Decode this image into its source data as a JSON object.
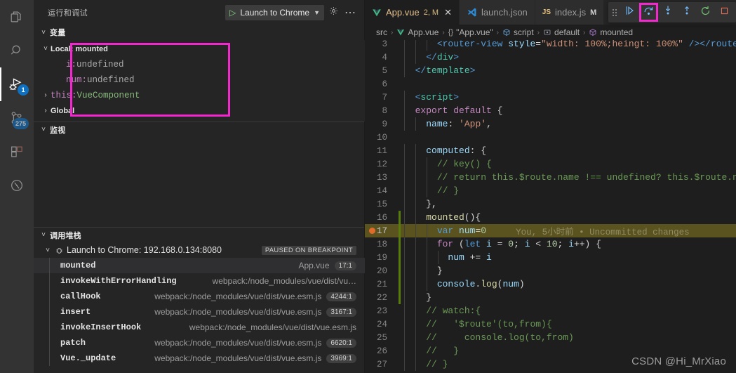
{
  "activitybar": {
    "items": [
      {
        "name": "explorer",
        "icon": "files-icon",
        "badge": null,
        "active": false
      },
      {
        "name": "search",
        "icon": "search-icon",
        "badge": null,
        "active": false
      },
      {
        "name": "run-and-debug",
        "icon": "debug-icon",
        "badge": "1",
        "active": true
      },
      {
        "name": "source-control",
        "icon": "source-control-icon",
        "badge": "275",
        "active": false
      },
      {
        "name": "extensions",
        "icon": "extensions-icon",
        "badge": null,
        "active": false
      },
      {
        "name": "testing",
        "icon": "beaker-clock-icon",
        "badge": null,
        "active": false
      }
    ]
  },
  "sidebar": {
    "title": "运行和调试",
    "launch_config": {
      "label": "Launch to Chrome",
      "play_icon": "play-icon",
      "chevron": "chevron-down-icon"
    },
    "gear_icon": "gear-icon",
    "more_icon": "ellipsis-icon",
    "sections": {
      "variables": {
        "title": "变量",
        "arrow": "chevron-down-icon",
        "highlight_color": "#f227cd",
        "rows": [
          {
            "indent": 0,
            "twisty": "chevron-down-icon",
            "scope": "Local: mounted"
          },
          {
            "indent": 1,
            "twisty": null,
            "key": "i",
            "sep": ": ",
            "value": "undefined"
          },
          {
            "indent": 1,
            "twisty": null,
            "key": "num",
            "sep": ": ",
            "value": "undefined"
          },
          {
            "indent": 0,
            "twisty": "chevron-right-icon",
            "key": "this",
            "sep": ": ",
            "type": "VueComponent"
          },
          {
            "indent": 0,
            "twisty": "chevron-right-icon",
            "scope": "Global"
          }
        ]
      },
      "watch": {
        "title": "监视",
        "arrow": "chevron-down-icon",
        "items": []
      },
      "callstack": {
        "title": "调用堆栈",
        "arrow": "chevron-down-icon",
        "session": {
          "arrow": "chevron-down-icon",
          "icon": "debug-session-icon",
          "label": "Launch to Chrome: 192.168.0.134:8080",
          "status": "PAUSED ON BREAKPOINT"
        },
        "frames": [
          {
            "fn": "mounted",
            "src": "App.vue",
            "line": "17:1",
            "selected": true
          },
          {
            "fn": "invokeWithErrorHandling",
            "src": "webpack:/node_modules/vue/dist/vu…",
            "line": null,
            "selected": false
          },
          {
            "fn": "callHook",
            "src": "webpack:/node_modules/vue/dist/vue.esm.js",
            "line": "4244:1",
            "selected": false
          },
          {
            "fn": "insert",
            "src": "webpack:/node_modules/vue/dist/vue.esm.js",
            "line": "3167:1",
            "selected": false
          },
          {
            "fn": "invokeInsertHook",
            "src": "webpack:/node_modules/vue/dist/vue.esm.js",
            "line": null,
            "selected": false
          },
          {
            "fn": "patch",
            "src": "webpack:/node_modules/vue/dist/vue.esm.js",
            "line": "6620:1",
            "selected": false
          },
          {
            "fn": "Vue._update",
            "src": "webpack:/node_modules/vue/dist/vue.esm.js",
            "line": "3969:1",
            "selected": false
          }
        ]
      }
    }
  },
  "editor": {
    "tabs": [
      {
        "name": "App.vue",
        "icon": "vue-icon",
        "badge": "2, M",
        "active": true,
        "close_icon": "close-icon",
        "modified": false
      },
      {
        "name": "launch.json",
        "icon": "vscode-icon",
        "badge": null,
        "active": false,
        "modified": false
      },
      {
        "name": "index.js",
        "icon": "js-icon",
        "badge": null,
        "active": false,
        "modified": true,
        "mod_mark": "M"
      }
    ],
    "debug_toolbar": {
      "grip_icon": "drag-handle-icon",
      "buttons": [
        {
          "name": "continue-button",
          "icon": "continue-icon",
          "highlighted": false
        },
        {
          "name": "step-over-button",
          "icon": "step-over-icon",
          "highlighted": true
        },
        {
          "name": "step-into-button",
          "icon": "step-into-icon",
          "highlighted": false
        },
        {
          "name": "step-out-button",
          "icon": "step-out-icon",
          "highlighted": false
        },
        {
          "name": "restart-button",
          "icon": "restart-icon",
          "highlighted": false
        },
        {
          "name": "stop-button",
          "icon": "stop-icon",
          "highlighted": false
        }
      ],
      "highlight_color": "#f227cd"
    },
    "breadcrumb": [
      {
        "text": "src",
        "icon": null
      },
      {
        "text": "App.vue",
        "icon": "vue-icon"
      },
      {
        "text": "\"App.vue\"",
        "icon": "braces-icon"
      },
      {
        "text": "script",
        "icon": "symbol-namespace-icon"
      },
      {
        "text": "default",
        "icon": "symbol-object-icon"
      },
      {
        "text": "mounted",
        "icon": "symbol-method-icon"
      }
    ],
    "blame_annotation": "You, 5小时前 • Uncommitted changes",
    "lines": [
      {
        "n": "3",
        "clipped": true,
        "segments": [
          {
            "t": "plain",
            "s": "      "
          },
          {
            "t": "tag",
            "s": "<router-view"
          },
          {
            "t": "prop",
            "s": " style"
          },
          {
            "t": "punc",
            "s": "="
          },
          {
            "t": "str",
            "s": "\"width: 100%;heingt: 100%\""
          },
          {
            "t": "tag",
            "s": " /></router-"
          }
        ]
      },
      {
        "n": "4",
        "segments": [
          {
            "t": "plain",
            "s": "    "
          },
          {
            "t": "tag",
            "s": "</"
          },
          {
            "t": "tagname2",
            "s": "div"
          },
          {
            "t": "tag",
            "s": ">"
          }
        ]
      },
      {
        "n": "5",
        "segments": [
          {
            "t": "plain",
            "s": "  "
          },
          {
            "t": "tag",
            "s": "</"
          },
          {
            "t": "tagname2",
            "s": "template"
          },
          {
            "t": "tag",
            "s": ">"
          }
        ]
      },
      {
        "n": "6",
        "segments": []
      },
      {
        "n": "7",
        "segments": [
          {
            "t": "plain",
            "s": "  "
          },
          {
            "t": "tag",
            "s": "<"
          },
          {
            "t": "tagname2",
            "s": "script"
          },
          {
            "t": "tag",
            "s": ">"
          }
        ]
      },
      {
        "n": "8",
        "segments": [
          {
            "t": "plain",
            "s": "  "
          },
          {
            "t": "kw",
            "s": "export"
          },
          {
            "t": "plain",
            "s": " "
          },
          {
            "t": "kw",
            "s": "default"
          },
          {
            "t": "punc",
            "s": " {"
          }
        ]
      },
      {
        "n": "9",
        "segments": [
          {
            "t": "plain",
            "s": "    "
          },
          {
            "t": "prop",
            "s": "name"
          },
          {
            "t": "punc",
            "s": ": "
          },
          {
            "t": "str",
            "s": "'App'"
          },
          {
            "t": "punc",
            "s": ","
          }
        ]
      },
      {
        "n": "10",
        "segments": []
      },
      {
        "n": "11",
        "segments": [
          {
            "t": "plain",
            "s": "    "
          },
          {
            "t": "prop",
            "s": "computed"
          },
          {
            "t": "punc",
            "s": ": {"
          }
        ]
      },
      {
        "n": "12",
        "segments": [
          {
            "t": "plain",
            "s": "      "
          },
          {
            "t": "com",
            "s": "// key() {"
          }
        ]
      },
      {
        "n": "13",
        "segments": [
          {
            "t": "plain",
            "s": "      "
          },
          {
            "t": "com",
            "s": "// return this.$route.name !== undefined? this.$route.name"
          }
        ]
      },
      {
        "n": "14",
        "segments": [
          {
            "t": "plain",
            "s": "      "
          },
          {
            "t": "com",
            "s": "// }"
          }
        ]
      },
      {
        "n": "15",
        "segments": [
          {
            "t": "plain",
            "s": "    "
          },
          {
            "t": "punc",
            "s": "},"
          }
        ]
      },
      {
        "n": "16",
        "changed": true,
        "segments": [
          {
            "t": "plain",
            "s": "    "
          },
          {
            "t": "fn",
            "s": "mounted"
          },
          {
            "t": "punc",
            "s": "(){"
          }
        ]
      },
      {
        "n": "17",
        "changed": true,
        "breakpoint": true,
        "highlight": true,
        "blame": true,
        "segments": [
          {
            "t": "plain",
            "s": "      "
          },
          {
            "t": "kw2",
            "s": "var"
          },
          {
            "t": "plain",
            "s": " "
          },
          {
            "t": "var",
            "s": "num"
          },
          {
            "t": "punc",
            "s": "="
          },
          {
            "t": "num",
            "s": "0"
          }
        ]
      },
      {
        "n": "18",
        "changed": true,
        "segments": [
          {
            "t": "plain",
            "s": "      "
          },
          {
            "t": "kw",
            "s": "for"
          },
          {
            "t": "punc",
            "s": " ("
          },
          {
            "t": "kw2",
            "s": "let"
          },
          {
            "t": "plain",
            "s": " "
          },
          {
            "t": "var",
            "s": "i"
          },
          {
            "t": "punc",
            "s": " = "
          },
          {
            "t": "num",
            "s": "0"
          },
          {
            "t": "punc",
            "s": "; "
          },
          {
            "t": "var",
            "s": "i"
          },
          {
            "t": "punc",
            "s": " < "
          },
          {
            "t": "num",
            "s": "10"
          },
          {
            "t": "punc",
            "s": "; "
          },
          {
            "t": "var",
            "s": "i"
          },
          {
            "t": "punc",
            "s": "++) {"
          }
        ]
      },
      {
        "n": "19",
        "changed": true,
        "segments": [
          {
            "t": "plain",
            "s": "        "
          },
          {
            "t": "var",
            "s": "num"
          },
          {
            "t": "punc",
            "s": " += "
          },
          {
            "t": "var",
            "s": "i"
          }
        ]
      },
      {
        "n": "20",
        "changed": true,
        "segments": [
          {
            "t": "plain",
            "s": "      "
          },
          {
            "t": "punc",
            "s": "}"
          }
        ]
      },
      {
        "n": "21",
        "changed": true,
        "segments": [
          {
            "t": "plain",
            "s": "      "
          },
          {
            "t": "var",
            "s": "console"
          },
          {
            "t": "punc",
            "s": "."
          },
          {
            "t": "fn",
            "s": "log"
          },
          {
            "t": "punc",
            "s": "("
          },
          {
            "t": "var",
            "s": "num"
          },
          {
            "t": "punc",
            "s": ")"
          }
        ]
      },
      {
        "n": "22",
        "changed": true,
        "segments": [
          {
            "t": "plain",
            "s": "    "
          },
          {
            "t": "punc",
            "s": "}"
          }
        ]
      },
      {
        "n": "23",
        "segments": [
          {
            "t": "plain",
            "s": "    "
          },
          {
            "t": "com",
            "s": "// watch:{"
          }
        ]
      },
      {
        "n": "24",
        "segments": [
          {
            "t": "plain",
            "s": "    "
          },
          {
            "t": "com",
            "s": "//   '$route'(to,from){"
          }
        ]
      },
      {
        "n": "25",
        "segments": [
          {
            "t": "plain",
            "s": "    "
          },
          {
            "t": "com",
            "s": "//     console.log(to,from)"
          }
        ]
      },
      {
        "n": "26",
        "segments": [
          {
            "t": "plain",
            "s": "    "
          },
          {
            "t": "com",
            "s": "//   }"
          }
        ]
      },
      {
        "n": "27",
        "segments": [
          {
            "t": "plain",
            "s": "    "
          },
          {
            "t": "com",
            "s": "// }"
          }
        ]
      }
    ]
  },
  "watermark": "CSDN @Hi_MrXiao"
}
